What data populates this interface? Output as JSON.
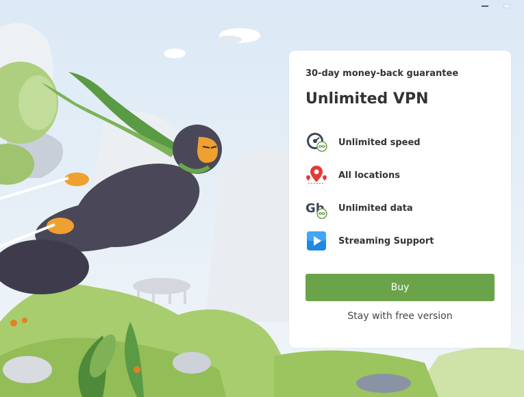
{
  "window": {
    "minimize_icon": "minimize-icon",
    "close_icon": "close-icon"
  },
  "offer": {
    "guarantee": "30-day money-back guarantee",
    "title": "Unlimited VPN"
  },
  "features": [
    {
      "icon": "speedometer-icon",
      "label": "Unlimited speed"
    },
    {
      "icon": "location-pin-icon",
      "label": "All locations"
    },
    {
      "icon": "data-icon",
      "label": "Unlimited data"
    },
    {
      "icon": "play-icon",
      "label": "Streaming Support"
    }
  ],
  "actions": {
    "buy_label": "Buy",
    "free_label": "Stay with free version"
  },
  "colors": {
    "accent": "#6ba34a",
    "background_sky": "#e6f0f8",
    "ninja_suit": "#4a4858",
    "ninja_accent": "#f0a030"
  }
}
